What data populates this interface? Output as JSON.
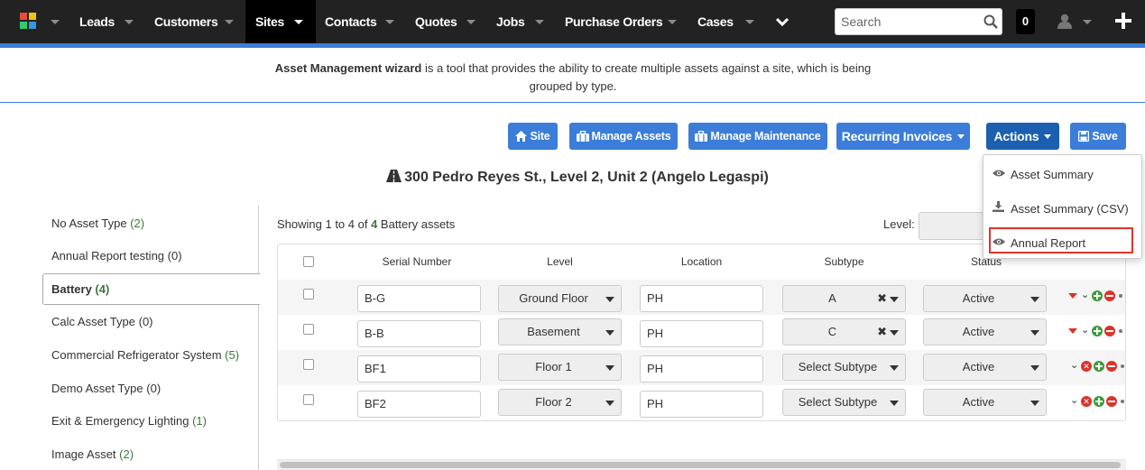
{
  "nav": {
    "items": [
      {
        "label": "Leads"
      },
      {
        "label": "Customers"
      },
      {
        "label": "Sites"
      },
      {
        "label": "Contacts"
      },
      {
        "label": "Quotes"
      },
      {
        "label": "Jobs"
      },
      {
        "label": "Purchase Orders"
      },
      {
        "label": "Cases"
      }
    ],
    "active": "Sites",
    "search_placeholder": "Search",
    "count": "0",
    "icons": [
      "app-logo-icon",
      "chevron-down-icon",
      "search-icon",
      "user-icon",
      "plus-icon"
    ]
  },
  "banner": {
    "bold": "Asset Management wizard",
    "text": " is a tool that provides the ability to create multiple assets against a site, which is being grouped by type."
  },
  "toolbar": {
    "site": "Site",
    "manage_assets": "Manage Assets",
    "manage_maintenance": "Manage Maintenance",
    "recurring_invoices": "Recurring Invoices",
    "actions": "Actions",
    "save": "Save"
  },
  "actions_menu": {
    "items": [
      "Asset Summary",
      "Asset Summary (CSV)",
      "Annual Report"
    ],
    "highlighted": "Annual Report"
  },
  "site_title": "300 Pedro Reyes St., Level 2, Unit 2 (Angelo Legaspi)",
  "sidebar": {
    "items": [
      {
        "name": "No Asset Type",
        "count": "(2)",
        "count_color": "#3c763d"
      },
      {
        "name": "Annual Report testing",
        "count": "(0)",
        "count_color": "#333333"
      },
      {
        "name": "Battery",
        "count": "(4)",
        "count_color": "#3c763d"
      },
      {
        "name": "Calc Asset Type",
        "count": "(0)",
        "count_color": "#333333"
      },
      {
        "name": "Commercial Refrigerator System",
        "count": "(5)",
        "count_color": "#3c763d"
      },
      {
        "name": "Demo Asset Type",
        "count": "(0)",
        "count_color": "#333333"
      },
      {
        "name": "Exit & Emergency Lighting",
        "count": "(1)",
        "count_color": "#3c763d"
      },
      {
        "name": "Image Asset",
        "count": "(2)",
        "count_color": "#3c763d"
      }
    ],
    "active": "Battery"
  },
  "main": {
    "showing_prefix": "Showing 1 to 4 of ",
    "showing_count": "4",
    "showing_suffix": " Battery assets",
    "level_label": "Level:"
  },
  "table": {
    "columns": [
      "Serial Number",
      "Level",
      "Location",
      "Subtype",
      "Status"
    ],
    "rows": [
      {
        "serial": "B-G",
        "level": "Ground Floor",
        "location": "PH",
        "subtype": "A",
        "status": "Active"
      },
      {
        "serial": "B-B",
        "level": "Basement",
        "location": "PH",
        "subtype": "C",
        "status": "Active"
      },
      {
        "serial": "BF1",
        "level": "Floor 1",
        "location": "PH",
        "subtype": "Select Subtype",
        "status": "Active"
      },
      {
        "serial": "BF2",
        "level": "Floor 2",
        "location": "PH",
        "subtype": "Select Subtype",
        "status": "Active"
      }
    ]
  },
  "colors": {
    "nav_bg": "#222222",
    "primary": "#3b7dd8",
    "primary_dark": "#1b5fb0",
    "highlight_box": "#e0352b",
    "count_green": "#3c763d"
  }
}
